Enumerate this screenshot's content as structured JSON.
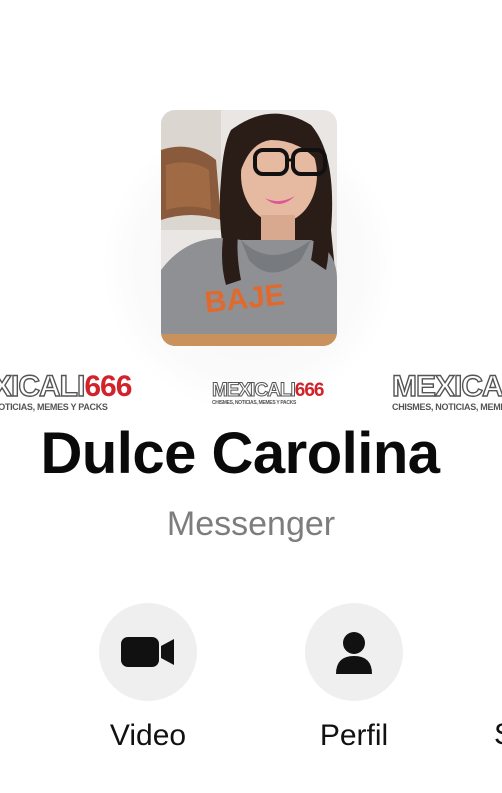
{
  "contact": {
    "name": "Dulce Carolina",
    "app": "Messenger"
  },
  "watermark": {
    "left_brand": "XICALI",
    "left_num": "666",
    "left_sub": "NOTICIAS, MEMES Y PACKS",
    "center_brand": "MEXICALI",
    "center_num": "666",
    "center_sub": "CHISMES, NOTICIAS, MEMES Y PACKS",
    "right_brand": "MEXICALI",
    "right_sub": "CHISMES, NOTICIAS, MEME"
  },
  "actions": [
    {
      "label": "Video",
      "icon": "video-camera-icon"
    },
    {
      "label": "Perfil",
      "icon": "person-icon"
    },
    {
      "label": "S",
      "icon": ""
    }
  ],
  "colors": {
    "background": "#ffffff",
    "action_circle": "#efefef",
    "secondary_text": "#7d7d7d",
    "watermark_accent": "#d2222a"
  }
}
